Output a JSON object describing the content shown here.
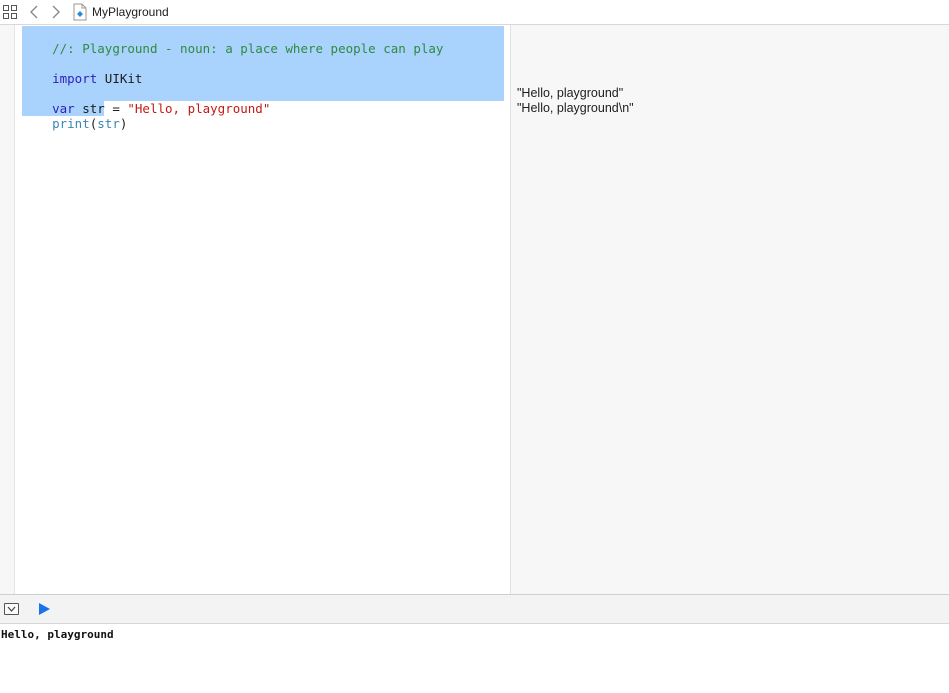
{
  "jumpbar": {
    "title": "MyPlayground",
    "icons": [
      "grid-icon",
      "back-arrow-icon",
      "forward-arrow-icon",
      "swift-file-icon"
    ]
  },
  "editor": {
    "lines": [
      {
        "tokens": [
          {
            "kind": "comment",
            "text": "//: Playground - noun: a place where people can play"
          }
        ]
      },
      {
        "tokens": [
          {
            "kind": "keyword",
            "text": "import"
          },
          {
            "kind": "plain",
            "text": " UIKit"
          }
        ]
      },
      {
        "tokens": [
          {
            "kind": "keyword",
            "text": "var"
          },
          {
            "kind": "plain",
            "text": " str = "
          },
          {
            "kind": "string",
            "text": "\"Hello, playground\""
          }
        ]
      },
      {
        "tokens": [
          {
            "kind": "func",
            "text": "print"
          },
          {
            "kind": "plain",
            "text": "("
          },
          {
            "kind": "func",
            "text": "str"
          },
          {
            "kind": "plain",
            "text": ")"
          }
        ]
      }
    ],
    "colors": {
      "comment": "#2e8b3d",
      "keyword": "#2c1fbe",
      "string": "#c41a16",
      "function": "#3a87b5",
      "selection": "#a9d3fd"
    }
  },
  "results": {
    "line1": "\"Hello, playground\"",
    "line2": "\"Hello, playground\\n\""
  },
  "debug": {
    "icons": [
      "toggle-console-icon",
      "play-icon"
    ],
    "play_color": "#1a73e8"
  },
  "console": {
    "output": "Hello, playground"
  }
}
